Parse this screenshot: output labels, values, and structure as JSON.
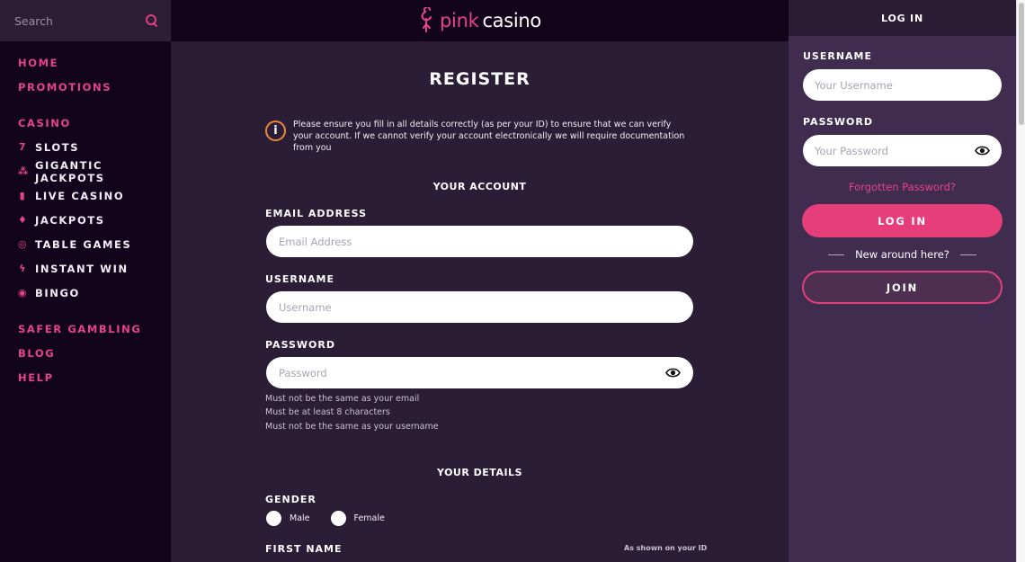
{
  "search": {
    "placeholder": "Search",
    "icon": "search-icon"
  },
  "logo": {
    "part1": "pink",
    "part2": "casino",
    "icon": "flamingo-icon"
  },
  "nav": {
    "top": [
      {
        "label": "HOME"
      },
      {
        "label": "PROMOTIONS"
      }
    ],
    "casino_heading": "CASINO",
    "casino_items": [
      {
        "label": "SLOTS",
        "icon": "slot-seven-icon",
        "glyph": "7"
      },
      {
        "label": "GIGANTIC JACKPOTS",
        "icon": "gigantic-jackpots-icon",
        "glyph": "⁂"
      },
      {
        "label": "LIVE CASINO",
        "icon": "playing-card-icon",
        "glyph": "▮"
      },
      {
        "label": "JACKPOTS",
        "icon": "diamond-icon",
        "glyph": "♦"
      },
      {
        "label": "TABLE GAMES",
        "icon": "roulette-icon",
        "glyph": "◎"
      },
      {
        "label": "INSTANT WIN",
        "icon": "lightning-icon",
        "glyph": "ϟ"
      },
      {
        "label": "BINGO",
        "icon": "bingo-ball-icon",
        "glyph": "◉"
      }
    ],
    "bottom": [
      {
        "label": "SAFER GAMBLING"
      },
      {
        "label": "BLOG"
      },
      {
        "label": "HELP"
      }
    ]
  },
  "register": {
    "title": "REGISTER",
    "notice": "Please ensure you fill in all details correctly (as per your ID) to ensure that we can verify your account. If we cannot verify your account electronically we will require documentation from you",
    "your_account_title": "YOUR ACCOUNT",
    "email_label": "EMAIL ADDRESS",
    "email_placeholder": "Email Address",
    "username_label": "USERNAME",
    "username_placeholder": "Username",
    "password_label": "PASSWORD",
    "password_placeholder": "Password",
    "password_hints": [
      "Must not be the same as your email",
      "Must be at least 8 characters",
      "Must not be the same as your username"
    ],
    "your_details_title": "YOUR DETAILS",
    "gender_label": "GENDER",
    "gender_options": [
      "Male",
      "Female"
    ],
    "first_name_label": "FIRST NAME",
    "first_name_note": "As shown on your ID"
  },
  "login": {
    "header": "LOG IN",
    "username_label": "USERNAME",
    "username_placeholder": "Your Username",
    "password_label": "PASSWORD",
    "password_placeholder": "Your Password",
    "forgot": "Forgotten Password?",
    "login_button": "LOG IN",
    "new_around": "New around here?",
    "join_button": "JOIN"
  },
  "colors": {
    "accent": "#e64388",
    "sidebar_bg": "#12041a",
    "main_bg": "#2c1d37",
    "login_bg": "#3f2c4f",
    "info_ring": "#e68a3a"
  }
}
